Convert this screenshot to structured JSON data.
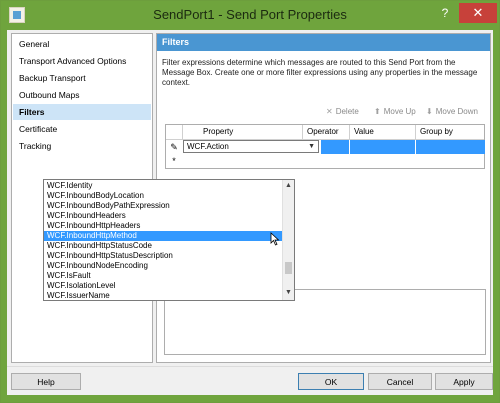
{
  "window": {
    "title": "SendPort1 - Send Port Properties",
    "help_glyph": "?",
    "close_glyph": "✕"
  },
  "nav": {
    "items": [
      {
        "label": "General"
      },
      {
        "label": "Transport Advanced Options"
      },
      {
        "label": "Backup Transport"
      },
      {
        "label": "Outbound Maps"
      },
      {
        "label": "Filters",
        "selected": true
      },
      {
        "label": "Certificate"
      },
      {
        "label": "Tracking"
      }
    ]
  },
  "panel": {
    "header": "Filters",
    "description": "Filter expressions determine which messages are routed to this Send Port from the Message Box. Create one or more filter expressions using any properties in the message context.",
    "actions": {
      "delete": "Delete",
      "move_up": "Move Up",
      "move_down": "Move Down"
    }
  },
  "grid": {
    "columns": [
      "Property",
      "Operator",
      "Value",
      "Group by"
    ],
    "row_edit_indicator": "✎",
    "row_new_indicator": "*",
    "current_property": "WCF.Action"
  },
  "dropdown": {
    "options": [
      "WCF.Identity",
      "WCF.InboundBodyLocation",
      "WCF.InboundBodyPathExpression",
      "WCF.InboundHeaders",
      "WCF.InboundHttpHeaders",
      "WCF.InboundHttpMethod",
      "WCF.InboundHttpStatusCode",
      "WCF.InboundHttpStatusDescription",
      "WCF.InboundNodeEncoding",
      "WCF.IsFault",
      "WCF.IsolationLevel",
      "WCF.IssuerName"
    ],
    "selected": "WCF.InboundHttpMethod"
  },
  "buttons": {
    "help": "Help",
    "ok": "OK",
    "cancel": "Cancel",
    "apply": "Apply"
  },
  "colors": {
    "titlebar": "#6fa43d",
    "panel_header": "#4a96d2",
    "selection": "#3399ff",
    "close": "#c7413a"
  }
}
